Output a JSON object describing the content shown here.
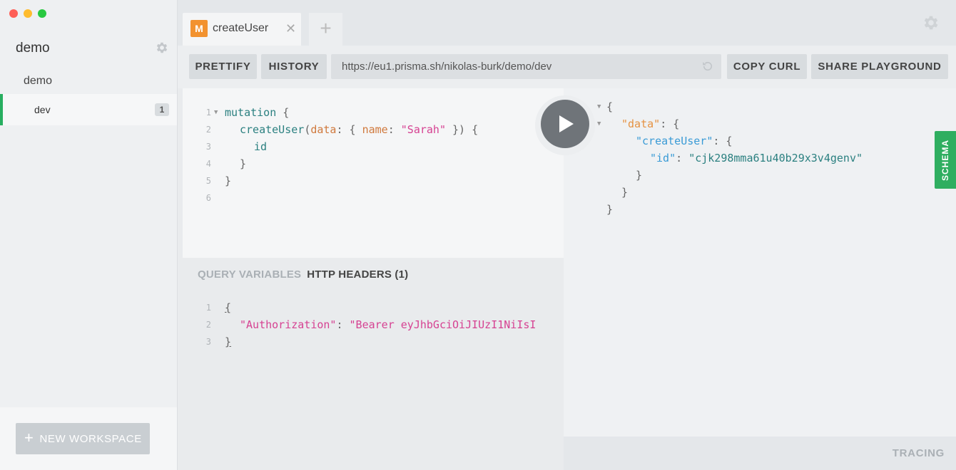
{
  "sidebar": {
    "workspace_title": "demo",
    "project_title": "demo",
    "stage_name": "dev",
    "stage_badge": "1",
    "new_workspace_label": "NEW WORKSPACE"
  },
  "tabs": [
    {
      "badge": "M",
      "label": "createUser"
    }
  ],
  "toolbar": {
    "prettify_label": "PRETTIFY",
    "history_label": "HISTORY",
    "endpoint_url": "https://eu1.prisma.sh/nikolas-burk/demo/dev",
    "copy_curl_label": "COPY CURL",
    "share_label": "SHARE PLAYGROUND"
  },
  "query": {
    "line_numbers": [
      "1",
      "2",
      "3",
      "4",
      "5",
      "6"
    ],
    "keyword": "mutation",
    "field": "createUser",
    "arg_name": "data",
    "input_key": "name",
    "input_value": "\"Sarah\"",
    "selection": "id"
  },
  "variables_panel": {
    "tab_query_variables": "QUERY VARIABLES",
    "tab_http_headers": "HTTP HEADERS (1)",
    "line_numbers": [
      "1",
      "2",
      "3"
    ],
    "header_key": "\"Authorization\"",
    "header_value": "\"Bearer eyJhbGciOiJIUzI1NiIsI"
  },
  "result": {
    "data_key": "\"data\"",
    "field_key": "\"createUser\"",
    "id_key": "\"id\"",
    "id_value": "\"cjk298mma61u40b29x3v4genv\""
  },
  "schema_label": "SCHEMA",
  "tracing_label": "TRACING",
  "colors": {
    "accent_green": "#27ae60",
    "mutation_badge": "#f2922f",
    "string": "#d64292",
    "keyword": "#2b8080"
  }
}
